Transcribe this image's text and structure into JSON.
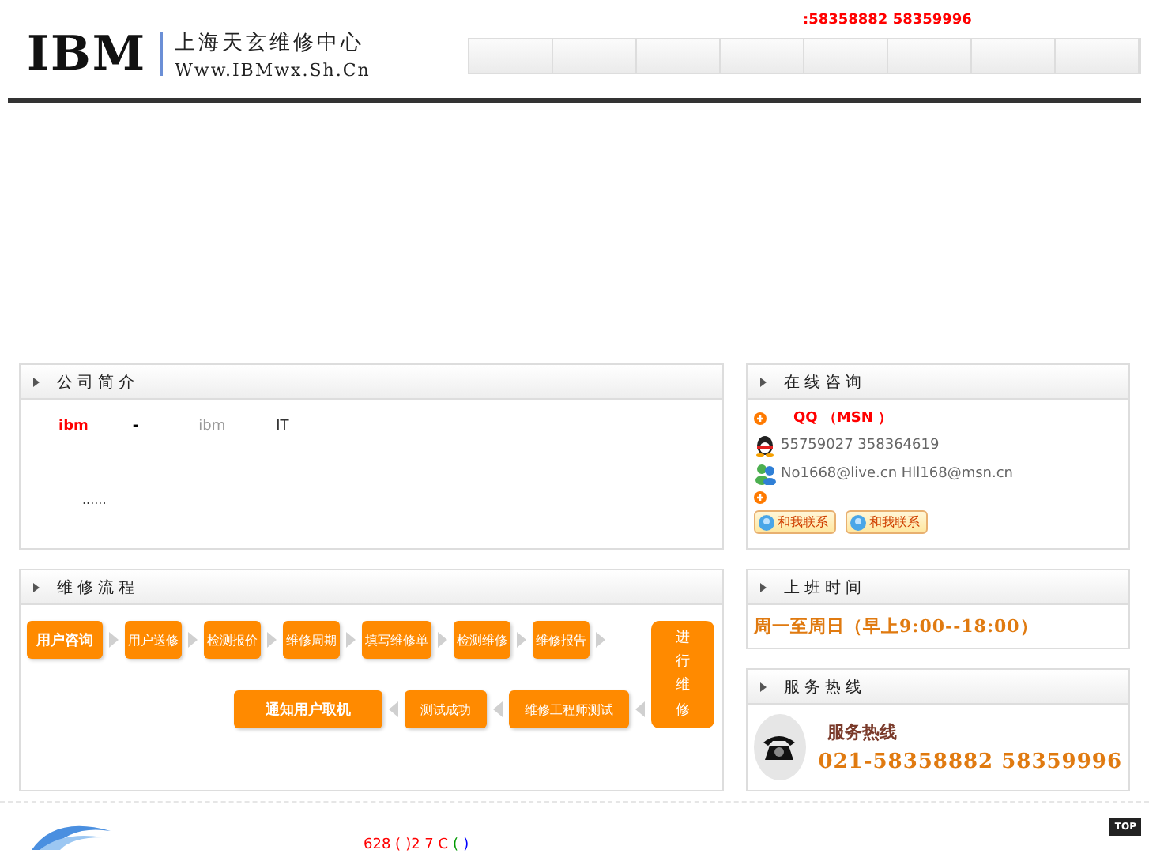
{
  "header": {
    "logo": "IBM",
    "site_name": "上海天玄维修中心",
    "site_url": "Www.IBMwx.Sh.Cn",
    "phone": ":58358882 58359996"
  },
  "intro": {
    "title": "公司简介",
    "line": [
      {
        "text": "ibm",
        "color": "#ff0000"
      },
      {
        "text": "-",
        "color": "#000000"
      },
      {
        "text": "ibm",
        "color": "#999999"
      },
      {
        "text": "IT",
        "color": "#333333"
      }
    ],
    "more": "......"
  },
  "contact": {
    "title": "在线咨询",
    "heading": "QQ （MSN ）",
    "qq": "55759027 358364619",
    "msn": "No1668@live.cn Hll168@msn.cn",
    "buttons": [
      "和我联系",
      "和我联系"
    ]
  },
  "process": {
    "title": "维修流程",
    "top_row": [
      {
        "label": "用户咨询",
        "emphasis": true
      },
      {
        "label": "用户送修",
        "emphasis": false
      },
      {
        "label": "检测报价",
        "emphasis": false
      },
      {
        "label": "维修周期",
        "emphasis": false
      },
      {
        "label": "填写维修单",
        "emphasis": false
      },
      {
        "label": "检测维修",
        "emphasis": false
      },
      {
        "label": "维修报告",
        "emphasis": false
      }
    ],
    "side": {
      "label": "进行维修"
    },
    "bottom_row": [
      {
        "label": "通知用户取机",
        "emphasis": true
      },
      {
        "label": "测试成功",
        "emphasis": false
      },
      {
        "label": "维修工程师测试",
        "emphasis": false
      }
    ]
  },
  "hours": {
    "title": "上班时间",
    "text": "周一至周日（早上9:00--18:00）"
  },
  "hotline": {
    "title": "服务热线",
    "label": "服务热线",
    "numbers": "021-58358882  58359996"
  },
  "footer": {
    "segments": [
      {
        "text": "628 (",
        "color": "#ff0000"
      },
      {
        "text": ")2 7 C",
        "color": "#ff0000"
      },
      {
        "text": "(",
        "color": "#009900"
      },
      {
        "text": ")",
        "color": "#0000ff"
      }
    ],
    "top_button": "TOP"
  }
}
